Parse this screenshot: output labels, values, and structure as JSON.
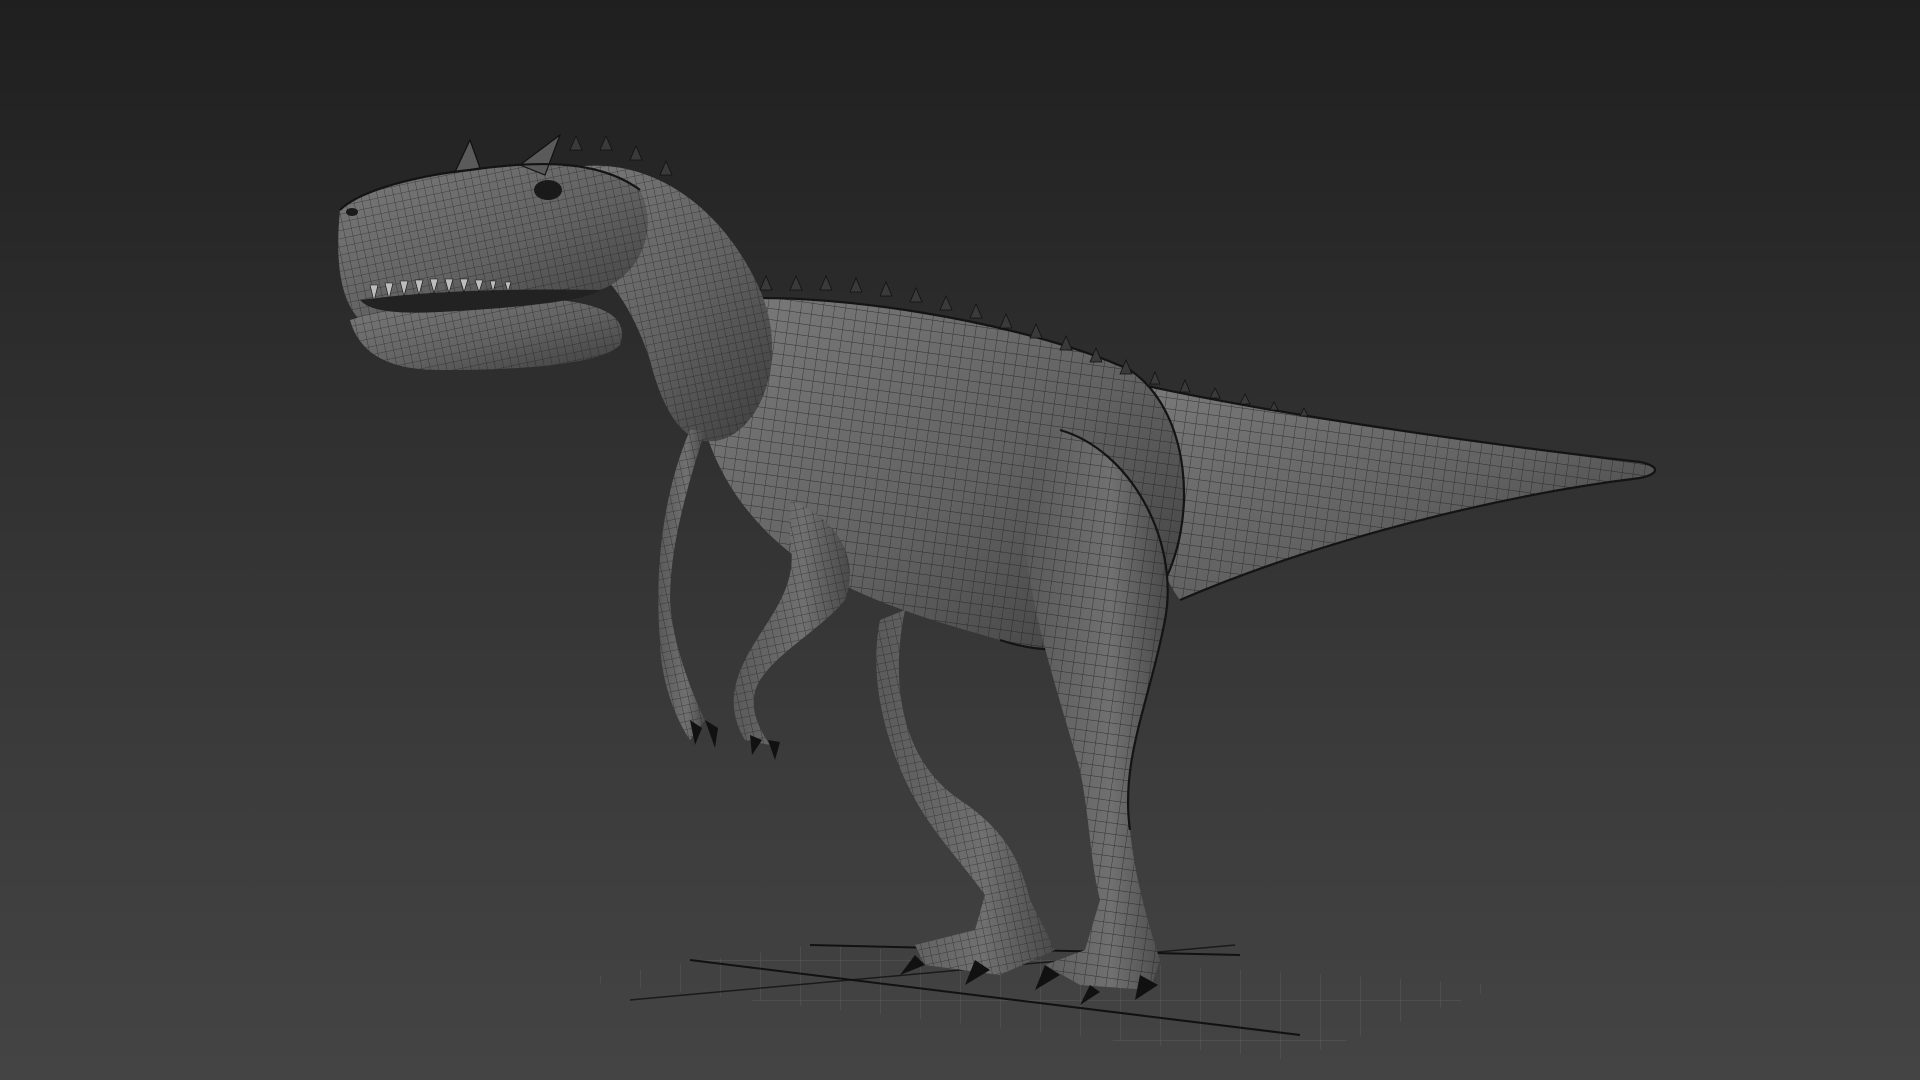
{
  "viewport": {
    "background_top": "#1f1f1f",
    "background_bottom": "#444444",
    "mesh_color": "#1a1a1a",
    "body_color": "#6a6a6a",
    "grid_color": "#7a7a7a"
  },
  "scene": {
    "object": "dinosaur-wireframe-model",
    "shading": "wireframe-on-shaded",
    "grid_visible": true
  }
}
